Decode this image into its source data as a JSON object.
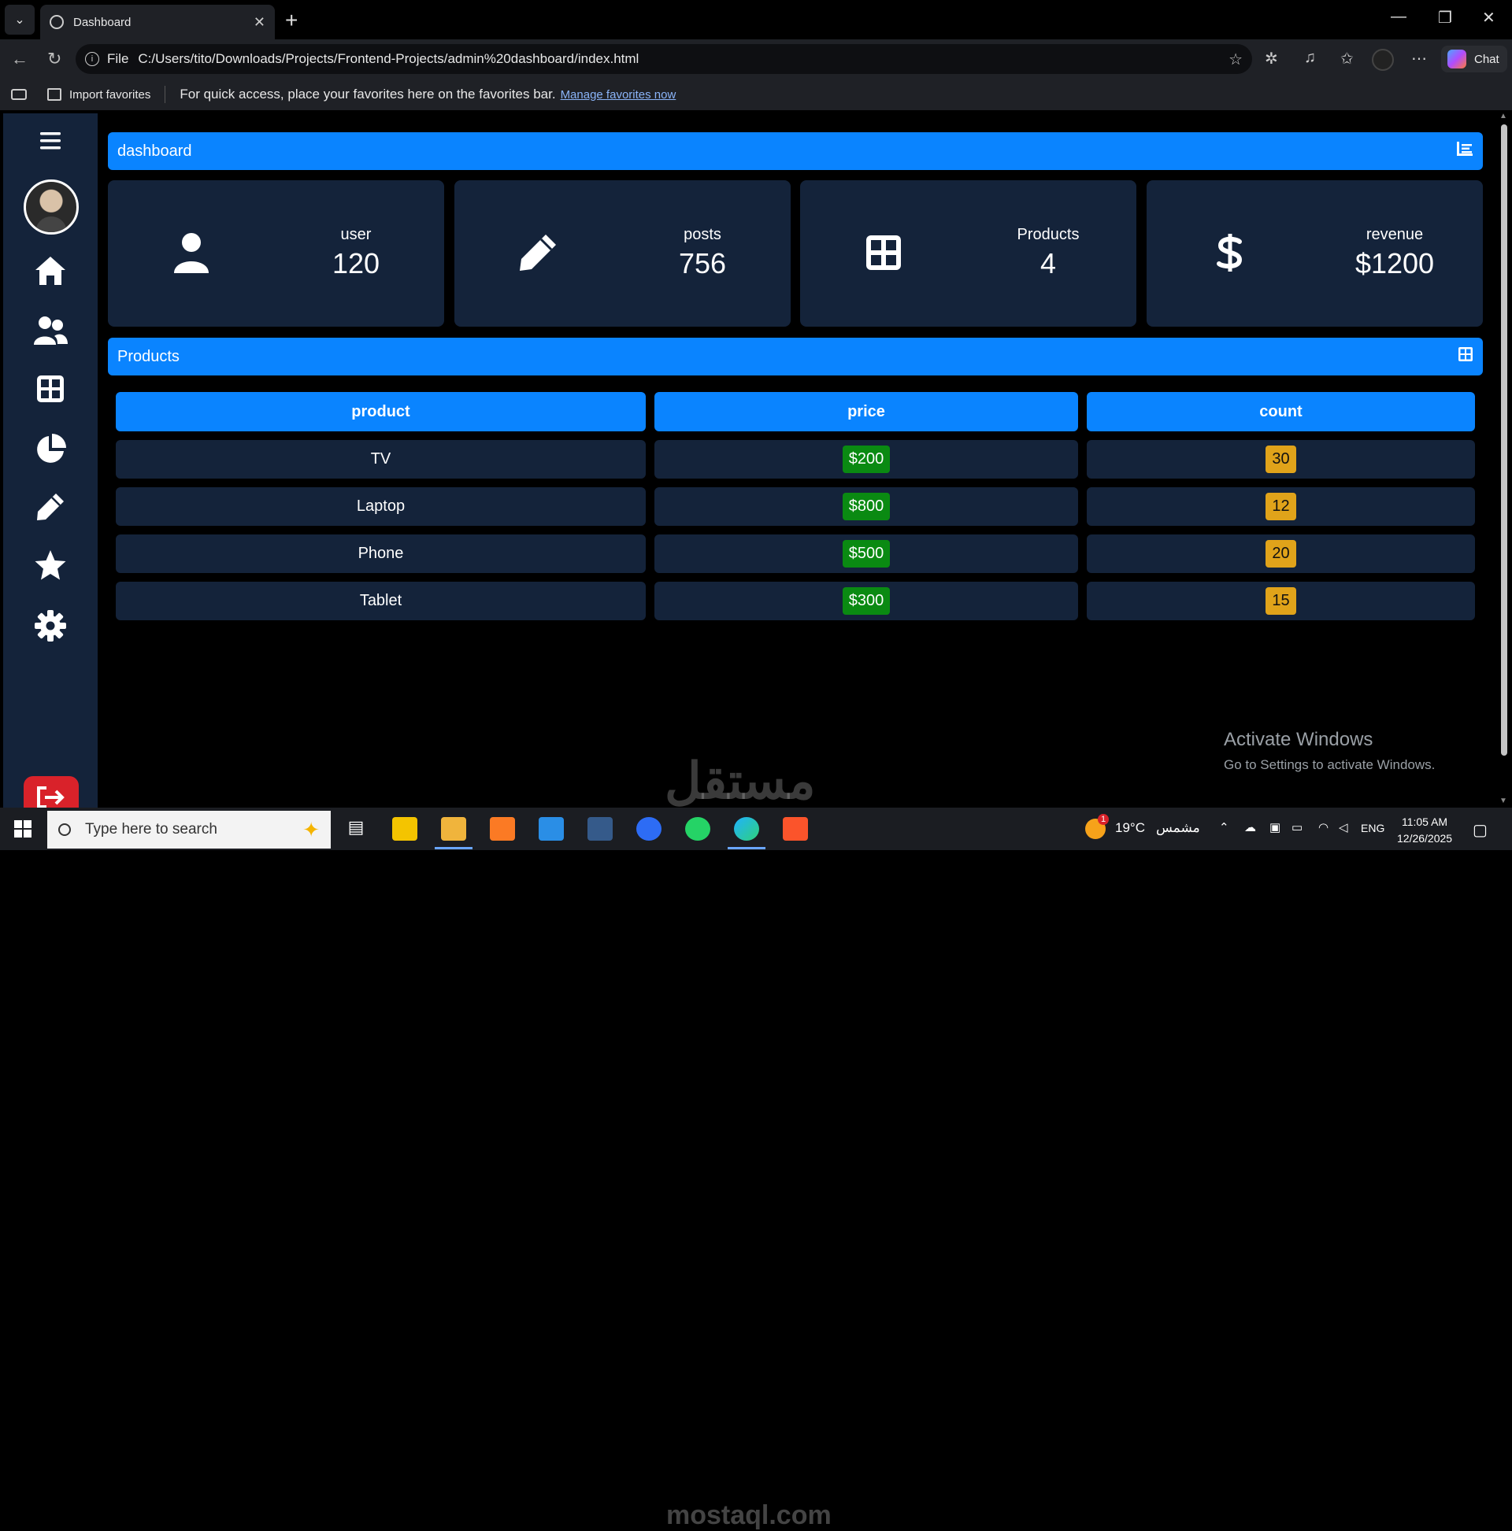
{
  "browser": {
    "tab_title": "Dashboard",
    "url_scheme": "File",
    "url": "C:/Users/tito/Downloads/Projects/Frontend-Projects/admin%20dashboard/index.html",
    "chat_label": "Chat",
    "favorites": {
      "import_label": "Import favorites",
      "message": "For quick access, place your favorites here on the favorites bar.",
      "link": "Manage favorites now"
    }
  },
  "dashboard": {
    "header_title": "dashboard",
    "cards": [
      {
        "label": "user",
        "value": "120",
        "icon": "user-icon"
      },
      {
        "label": "posts",
        "value": "756",
        "icon": "pencil-icon"
      },
      {
        "label": "Products",
        "value": "4",
        "icon": "grid-icon"
      },
      {
        "label": "revenue",
        "value": "$1200",
        "icon": "dollar-icon"
      }
    ],
    "products_title": "Products",
    "table": {
      "headers": [
        "product",
        "price",
        "count"
      ],
      "rows": [
        {
          "product": "TV",
          "price": "$200",
          "count": "30"
        },
        {
          "product": "Laptop",
          "price": "$800",
          "count": "12"
        },
        {
          "product": "Phone",
          "price": "$500",
          "count": "20"
        },
        {
          "product": "Tablet",
          "price": "$300",
          "count": "15"
        }
      ]
    }
  },
  "watermark": {
    "activate_title": "Activate Windows",
    "activate_sub": "Go to Settings to activate Windows.",
    "site_ar": "مستقل",
    "site": "mostaql.com"
  },
  "taskbar": {
    "search_placeholder": "Type here to search",
    "weather": "19°C",
    "weather_desc": "مشمس",
    "weather_badge": "1",
    "lang": "ENG",
    "time": "11:05 AM",
    "date": "12/26/2025"
  },
  "colors": {
    "accent": "#0a84ff",
    "panel": "#14233a",
    "price_badge": "#0a8a12",
    "count_badge": "#e0a31a",
    "logout": "#d9222a"
  }
}
